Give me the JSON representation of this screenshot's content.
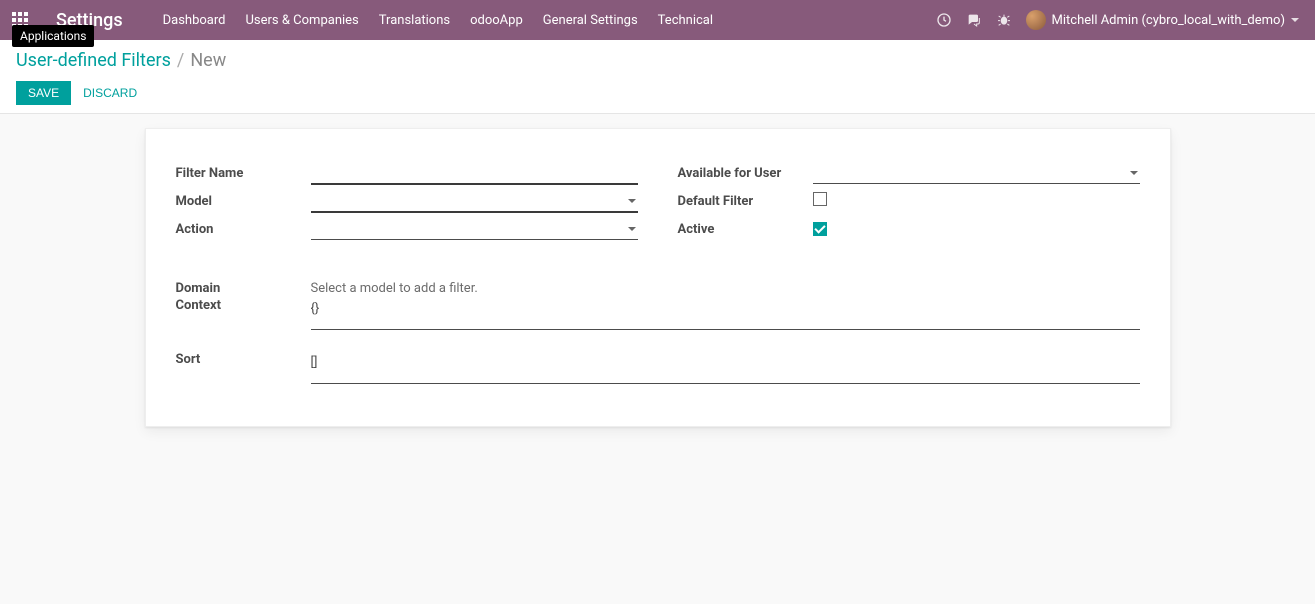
{
  "navbar": {
    "brand": "Settings",
    "tooltip": "Applications",
    "menu": [
      "Dashboard",
      "Users & Companies",
      "Translations",
      "odooApp",
      "General Settings",
      "Technical"
    ],
    "user": "Mitchell Admin (cybro_local_with_demo)"
  },
  "breadcrumb": {
    "parent": "User-defined Filters",
    "current": "New"
  },
  "actions": {
    "save": "SAVE",
    "discard": "DISCARD"
  },
  "form": {
    "left": {
      "filter_name": {
        "label": "Filter Name",
        "value": ""
      },
      "model": {
        "label": "Model",
        "value": ""
      },
      "action": {
        "label": "Action",
        "value": ""
      }
    },
    "right": {
      "available_user": {
        "label": "Available for User",
        "value": ""
      },
      "default_filter": {
        "label": "Default Filter",
        "checked": false
      },
      "active": {
        "label": "Active",
        "checked": true
      }
    },
    "domain": {
      "label": "Domain",
      "hint": "Select a model to add a filter."
    },
    "context": {
      "label": "Context",
      "value": "{}"
    },
    "sort": {
      "label": "Sort",
      "value": "[]"
    }
  }
}
